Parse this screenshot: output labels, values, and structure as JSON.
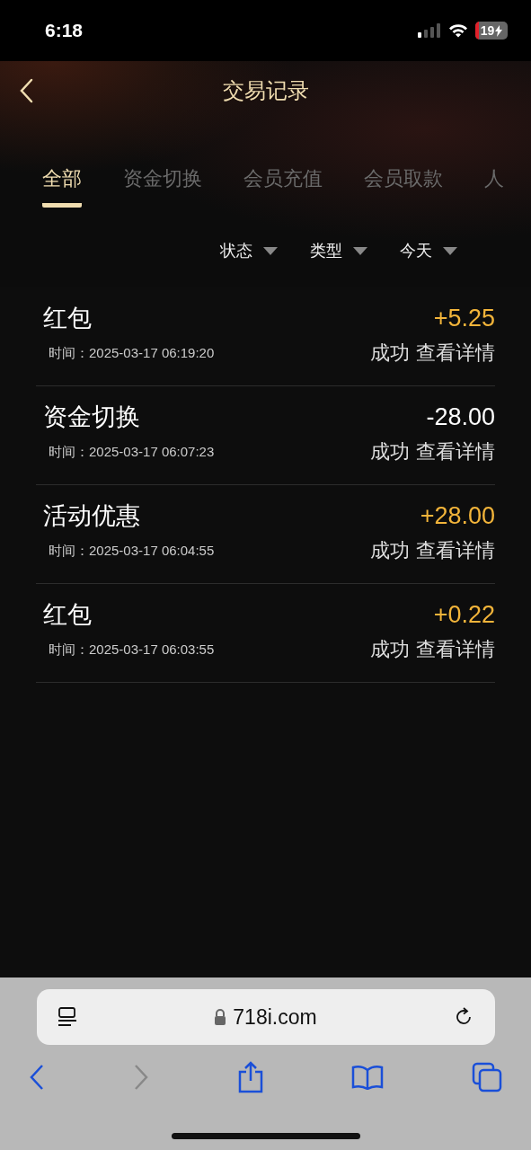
{
  "status_bar": {
    "time": "6:18",
    "battery": "19"
  },
  "header": {
    "title": "交易记录"
  },
  "tabs": [
    {
      "label": "全部",
      "selected": true
    },
    {
      "label": "资金切换",
      "selected": false
    },
    {
      "label": "会员充值",
      "selected": false
    },
    {
      "label": "会员取款",
      "selected": false
    },
    {
      "label": "人",
      "selected": false
    }
  ],
  "filters": [
    "状态",
    "类型",
    "今天"
  ],
  "records": [
    {
      "title": "红包",
      "time": "时间：2025-03-17 06:19:20",
      "amount": "+5.25",
      "color": "#f2b43a",
      "status": "成功",
      "details_link": "查看详情"
    },
    {
      "title": "资金切换",
      "time": "时间：2025-03-17 06:07:23",
      "amount": "-28.00",
      "color": "#ffffff",
      "status": "成功",
      "details_link": "查看详情"
    },
    {
      "title": "活动优惠",
      "time": "时间：2025-03-17 06:04:55",
      "amount": "+28.00",
      "color": "#f2b43a",
      "status": "成功",
      "details_link": "查看详情"
    },
    {
      "title": "红包",
      "time": "时间：2025-03-17 06:03:55",
      "amount": "+0.22",
      "color": "#f2b43a",
      "status": "成功",
      "details_link": "查看详情"
    }
  ],
  "browser": {
    "url": "718i.com",
    "forward_disabled": true
  }
}
